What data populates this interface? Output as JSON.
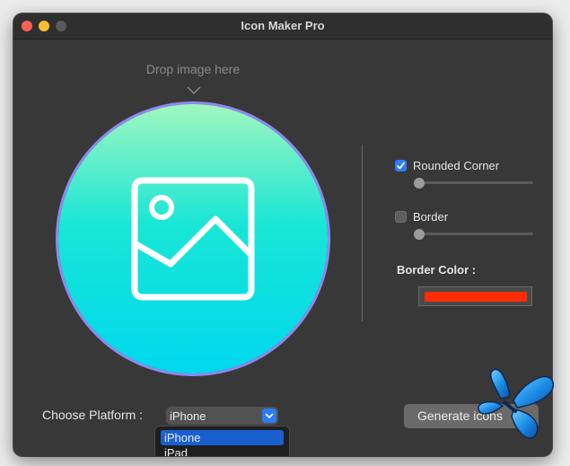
{
  "window": {
    "title": "Icon Maker Pro"
  },
  "drop_zone": {
    "label": "Drop image here"
  },
  "options": {
    "rounded_corner": {
      "label": "Rounded Corner",
      "checked": true,
      "level": 0
    },
    "border": {
      "label": "Border",
      "checked": false,
      "level": 0
    },
    "border_color": {
      "label": "Border Color :",
      "value": "#ff2a06"
    }
  },
  "platform": {
    "label": "Choose Platform :",
    "selected": "iPhone",
    "options": [
      "iPhone",
      "iPad"
    ]
  },
  "actions": {
    "generate_label": "Generate icons"
  },
  "colors": {
    "accent": "#2b7cf6",
    "preview_ring": "#8f88f0",
    "gradient_top": "#a0f7bf",
    "gradient_bottom": "#00d8ee"
  }
}
